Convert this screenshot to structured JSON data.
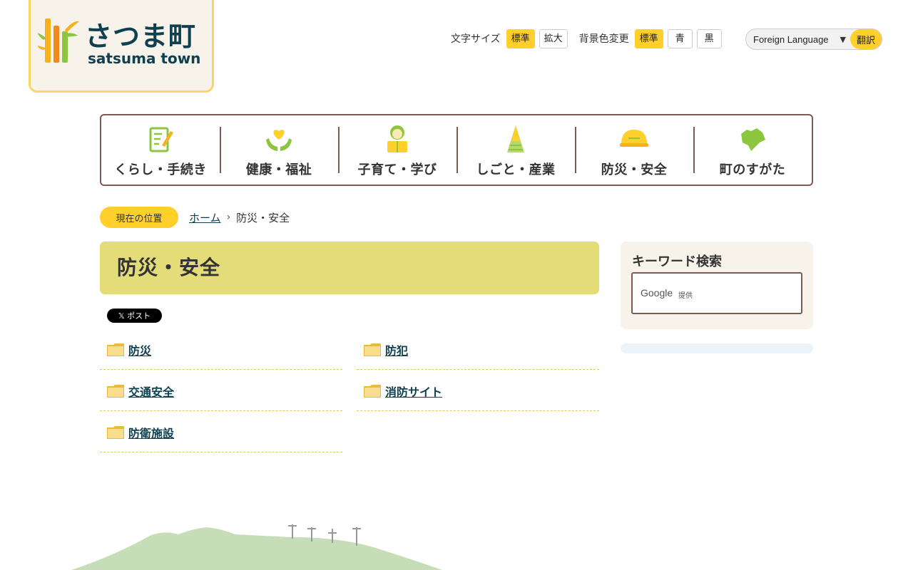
{
  "logo": {
    "name_jp": "さつま町",
    "name_en": "satsuma town"
  },
  "tools": {
    "font_size_label": "文字サイズ",
    "font_standard": "標準",
    "font_large": "拡大",
    "bg_label": "背景色変更",
    "bg_standard": "標準",
    "bg_blue": "青",
    "bg_black": "黒"
  },
  "language": {
    "select_label": "Foreign Language",
    "arrow": "▼",
    "translate_button": "翻訳"
  },
  "nav": {
    "items": [
      {
        "label": "くらし・手続き",
        "icon": "document-pen-icon"
      },
      {
        "label": "健康・福祉",
        "icon": "heart-hands-icon"
      },
      {
        "label": "子育て・学び",
        "icon": "child-book-icon"
      },
      {
        "label": "しごと・産業",
        "icon": "bamboo-shoot-icon"
      },
      {
        "label": "防災・安全",
        "icon": "helmet-icon"
      },
      {
        "label": "町のすがた",
        "icon": "town-map-icon"
      }
    ]
  },
  "breadcrumb": {
    "badge": "現在の位置",
    "home": "ホーム",
    "separator": "›",
    "current": "防災・安全"
  },
  "page": {
    "title": "防災・安全",
    "x_post": "𝕏 ポスト"
  },
  "categories": [
    "防災",
    "防犯",
    "交通安全",
    "消防サイト",
    "防衛施設"
  ],
  "sidebar": {
    "search_title": "キーワード検索",
    "google": "Google",
    "provided": "提供"
  },
  "colors": {
    "accent_yellow": "#ffcf2b",
    "title_bg": "#e4dc78",
    "nav_border": "#7e5a52",
    "link": "#0f4050"
  }
}
